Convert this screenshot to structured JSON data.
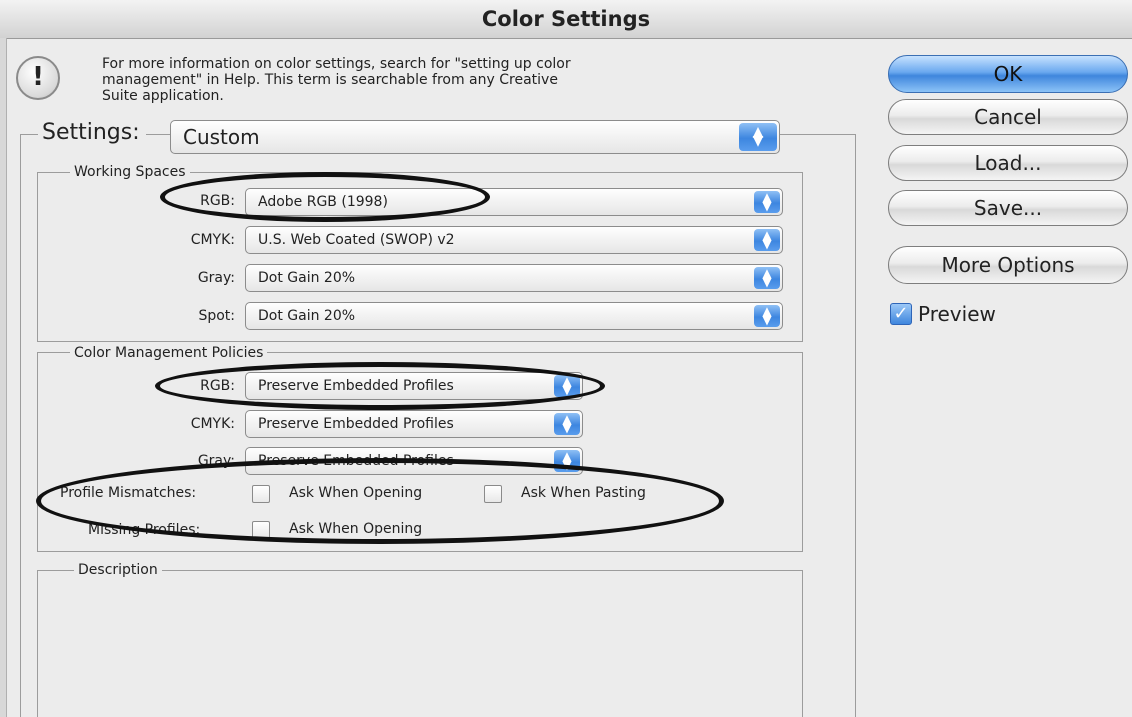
{
  "window": {
    "title": "Color Settings"
  },
  "info": {
    "icon": "alert-icon",
    "icon_glyph": "!",
    "line1": "For more information on color settings, search for \"setting up color",
    "line2": "management\" in Help. This term is searchable from any Creative",
    "line3": "Suite application."
  },
  "settings": {
    "label": "Settings:",
    "value": "Custom"
  },
  "working_spaces": {
    "title": "Working Spaces",
    "rows": [
      {
        "label": "RGB:",
        "value": "Adobe RGB (1998)"
      },
      {
        "label": "CMYK:",
        "value": "U.S. Web Coated (SWOP) v2"
      },
      {
        "label": "Gray:",
        "value": "Dot Gain 20%"
      },
      {
        "label": "Spot:",
        "value": "Dot Gain 20%"
      }
    ]
  },
  "policies": {
    "title": "Color Management Policies",
    "rows": [
      {
        "label": "RGB:",
        "value": "Preserve Embedded Profiles"
      },
      {
        "label": "CMYK:",
        "value": "Preserve Embedded Profiles"
      },
      {
        "label": "Gray:",
        "value": "Preserve Embedded Profiles"
      }
    ],
    "profile_mismatches": {
      "label": "Profile Mismatches:",
      "ask_opening": "Ask When Opening",
      "ask_pasting": "Ask When Pasting"
    },
    "missing_profiles": {
      "label": "Missing Profiles:",
      "ask_opening": "Ask When Opening"
    }
  },
  "description": {
    "title": "Description"
  },
  "buttons": {
    "ok": "OK",
    "cancel": "Cancel",
    "load": "Load...",
    "save": "Save...",
    "more_options": "More Options"
  },
  "preview": {
    "label": "Preview",
    "checked": true
  },
  "colors": {
    "accent": "#3f86dd",
    "annotation": "#111111"
  }
}
